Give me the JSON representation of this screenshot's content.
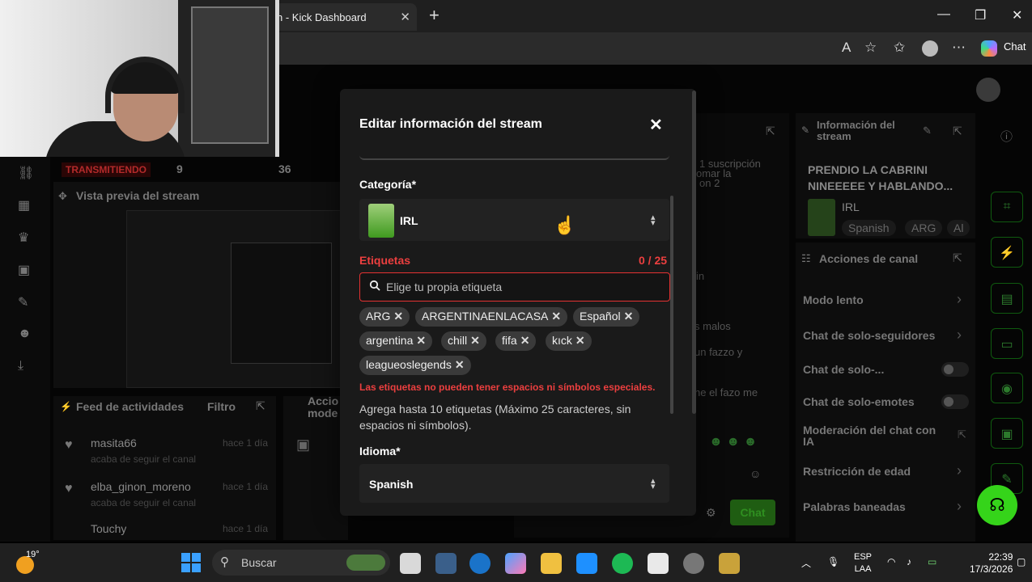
{
  "browser": {
    "tab_title": "n - Kick Dashboard",
    "tab_close": "✕",
    "new_tab": "+",
    "chat_button": "Chat"
  },
  "dashboard": {
    "live_badge": "TRANSMITIENDO",
    "stat_a": "9",
    "stat_b": "36",
    "preview_title": "Vista previa del stream",
    "feed_title": "Feed de actividades",
    "feed_filter": "Filtro",
    "actions_panel_title": "Accio mode",
    "feed_items": [
      {
        "user": "masita66",
        "action": "acaba de seguir el canal",
        "time": "hace 1 día"
      },
      {
        "user": "elba_ginon_moreno",
        "action": "acaba de seguir el canal",
        "time": "hace 1 día"
      },
      {
        "user": "Touchy",
        "action": "",
        "time": "hace 1 día"
      }
    ],
    "chat_lines": [
      "1 suscripción",
      "omar la",
      "on 2",
      "in",
      "s malos",
      "un fazzo y",
      "he el fazo me"
    ],
    "chat_send": "Chat",
    "info_title": "Información del stream",
    "info_stream_name": "PRENDIO LA CABRINI NINEEEEE Y HABLANDO...",
    "info_category": "IRL",
    "info_tags": [
      "Spanish",
      "ARG",
      "Al"
    ],
    "actions_title": "Acciones de canal",
    "actions": [
      {
        "label": "Modo lento",
        "kind": "chevron"
      },
      {
        "label": "Chat de solo-seguidores",
        "kind": "chevron"
      },
      {
        "label": "Chat de solo-...",
        "kind": "toggle"
      },
      {
        "label": "Chat de solo-emotes",
        "kind": "toggle"
      },
      {
        "label": "Moderación del chat con IA",
        "kind": "external"
      },
      {
        "label": "Restricción de edad",
        "kind": "chevron"
      },
      {
        "label": "Palabras baneadas",
        "kind": "chevron"
      }
    ]
  },
  "modal": {
    "title": "Editar información del stream",
    "close": "✕",
    "category_label": "Categoría*",
    "category_value": "IRL",
    "tags_label": "Etiquetas",
    "tags_count": "0 / 25",
    "tags_placeholder": "Elige tu propia etiqueta",
    "tags": [
      "ARG",
      "ARGENTINAENLACASA",
      "Español",
      "argentina",
      "chill",
      "fifa",
      "kıck",
      "leagueoslegends"
    ],
    "tags_error": "Las etiquetas no pueden tener espacios ni símbolos especiales.",
    "tags_help": "Agrega hasta 10 etiquetas (Máximo 25 caracteres, sin espacios ni símbolos).",
    "language_label": "Idioma*",
    "language_value": "Spanish"
  },
  "taskbar": {
    "temperature": "19°",
    "search_label": "Buscar",
    "lang_top": "ESP",
    "lang_bottom": "LAA",
    "time": "22:39",
    "date": "17/3/2026"
  },
  "colors": {
    "accent_green": "#35d41a",
    "error_red": "#ec3f3f",
    "modal_bg": "#1a1a1a"
  }
}
